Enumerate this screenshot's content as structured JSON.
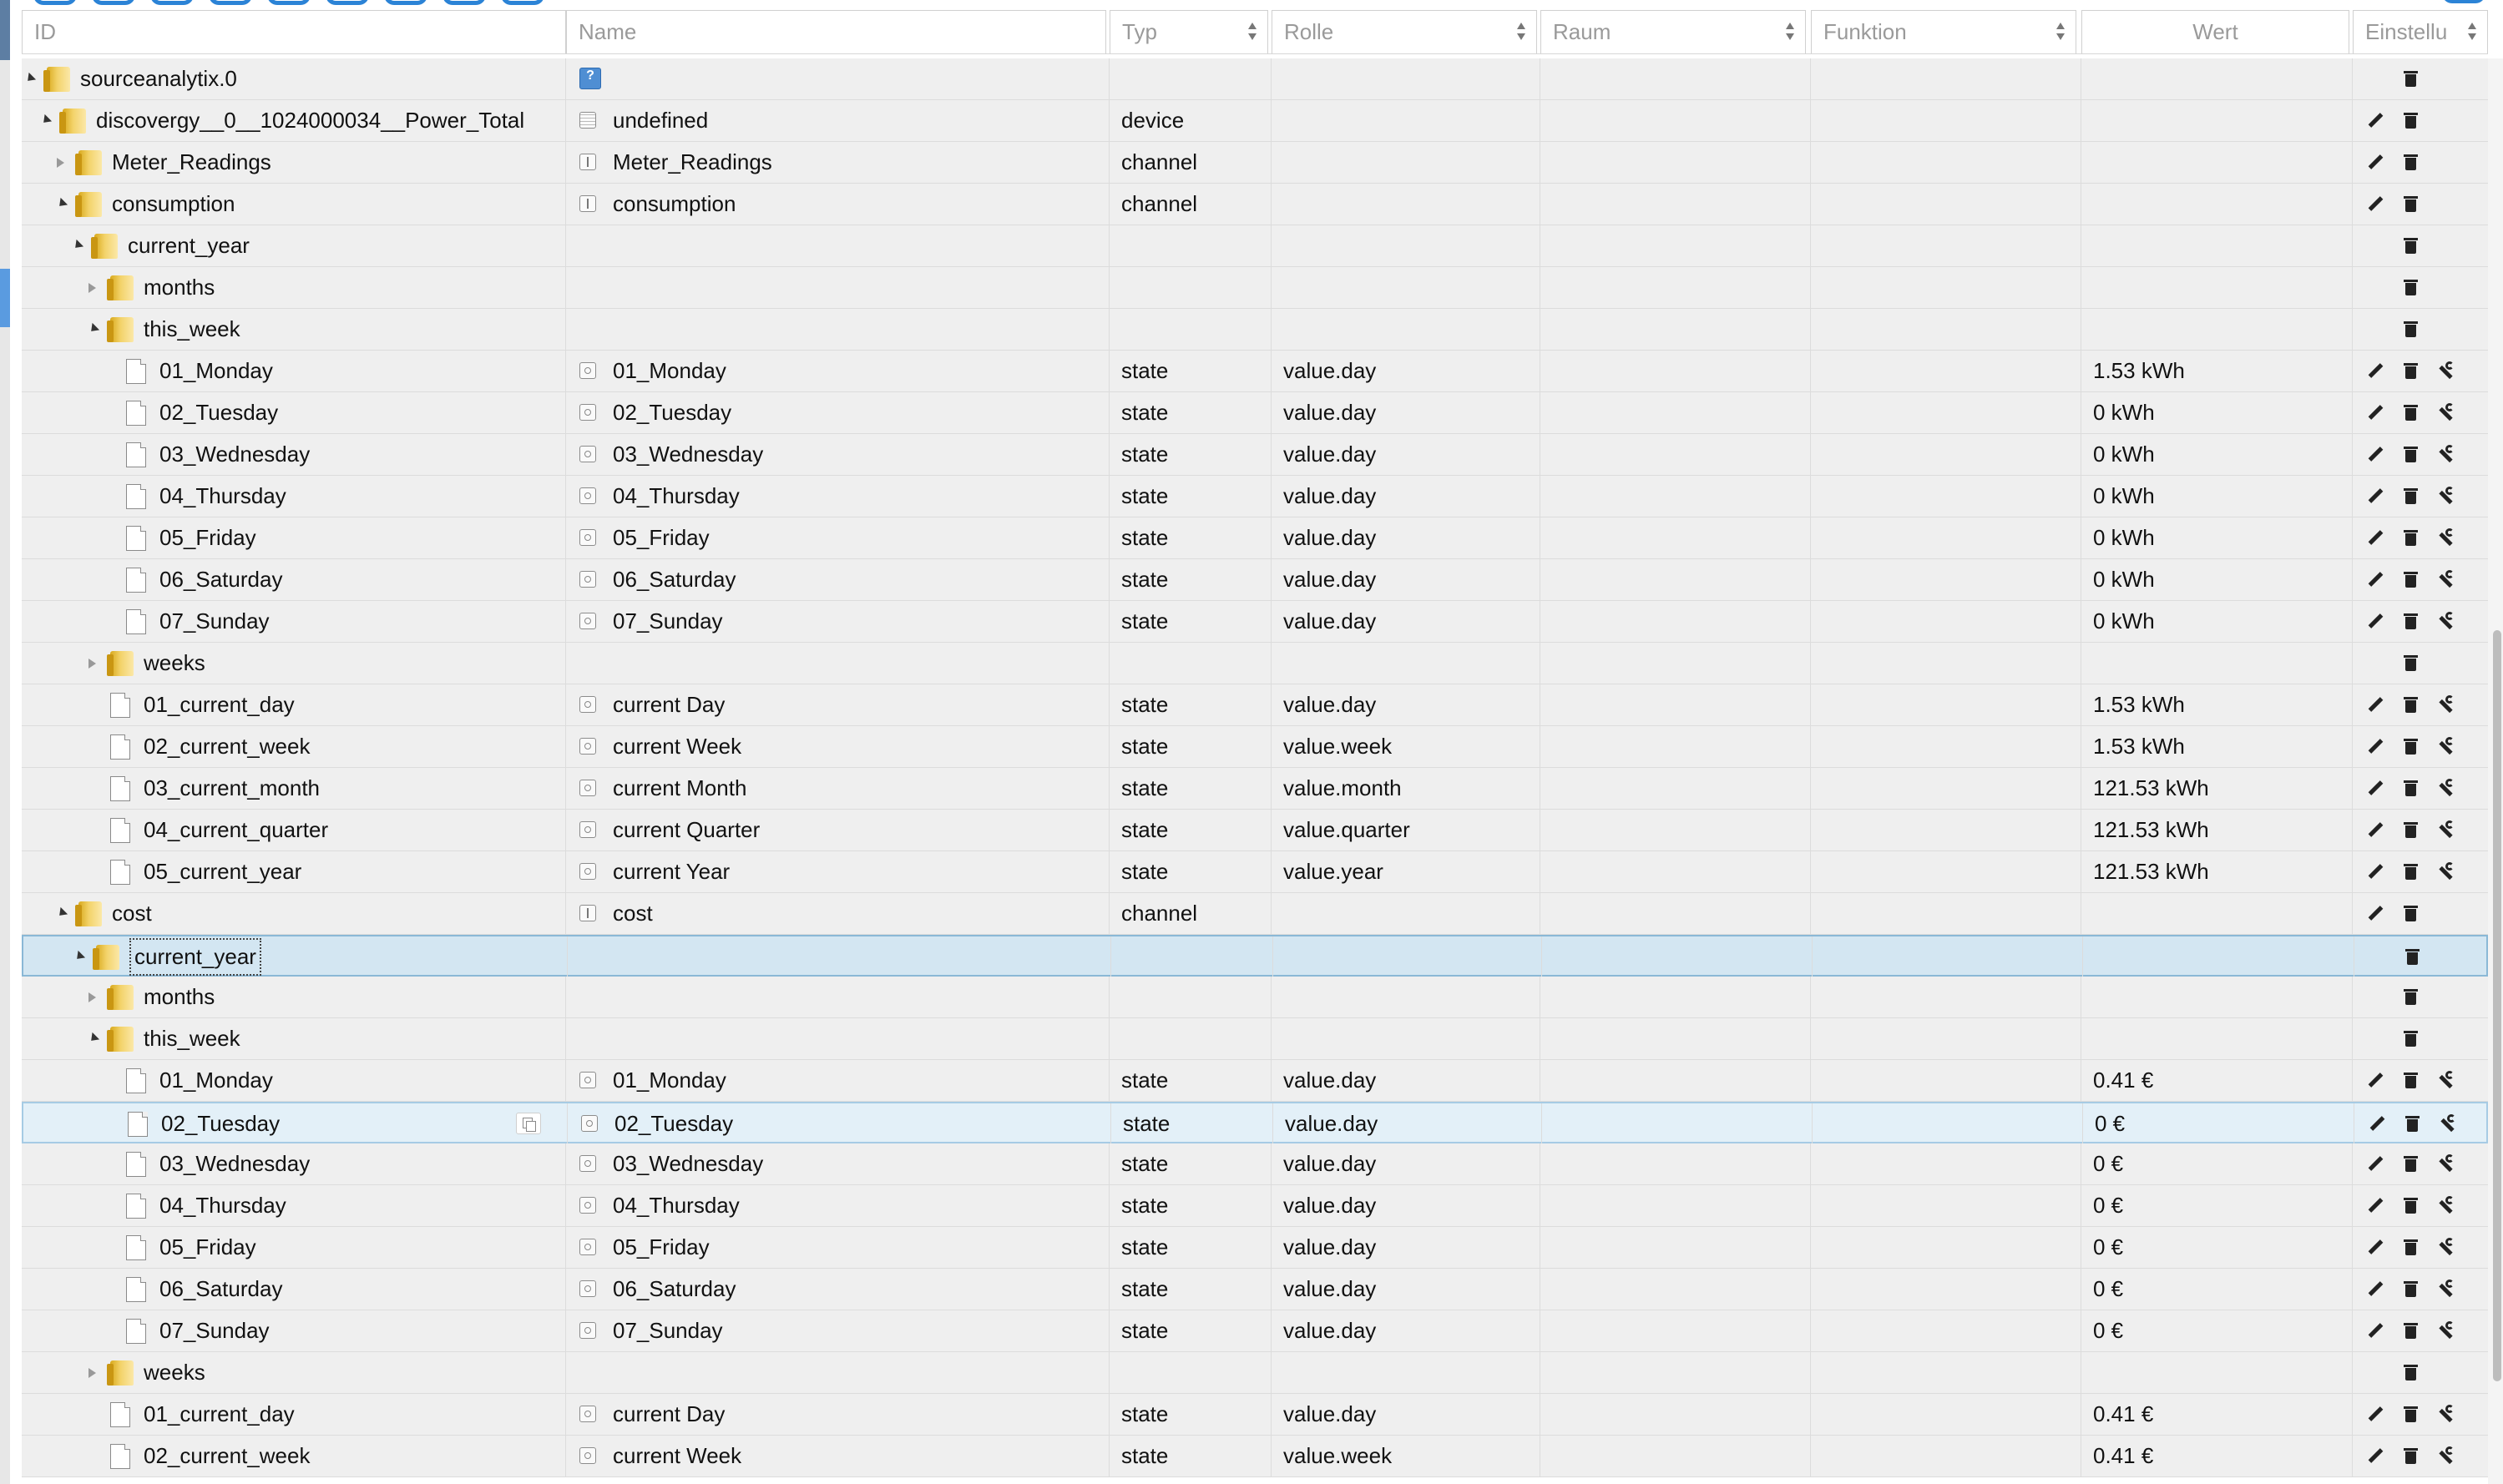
{
  "header": {
    "id": "ID",
    "name": "Name",
    "typ": "Typ",
    "rolle": "Rolle",
    "raum": "Raum",
    "funktion": "Funktion",
    "wert": "Wert",
    "einstellungen": "Einstellu"
  },
  "rows": [
    {
      "id": "sourceanalytix.0",
      "depth": 0,
      "kind": "folder",
      "twisty": "exp",
      "name_icon": "unknown-icon",
      "name": "",
      "typ": "",
      "rolle": "",
      "wert": "",
      "actions": [
        "delete"
      ]
    },
    {
      "id": "discovergy__0__1024000034__Power_Total",
      "depth": 1,
      "kind": "folder",
      "twisty": "exp",
      "name_icon": "device-icon",
      "name": "undefined",
      "typ": "device",
      "rolle": "",
      "wert": "",
      "actions": [
        "edit",
        "delete"
      ]
    },
    {
      "id": "Meter_Readings",
      "depth": 2,
      "kind": "folder",
      "twisty": "col",
      "name_icon": "channel-icon",
      "name": "Meter_Readings",
      "typ": "channel",
      "rolle": "",
      "wert": "",
      "actions": [
        "edit",
        "delete"
      ]
    },
    {
      "id": "consumption",
      "depth": 2,
      "kind": "folder",
      "twisty": "exp",
      "name_icon": "channel-icon",
      "name": "consumption",
      "typ": "channel",
      "rolle": "",
      "wert": "",
      "actions": [
        "edit",
        "delete"
      ]
    },
    {
      "id": "current_year",
      "depth": 3,
      "kind": "folder",
      "twisty": "exp",
      "name_icon": "",
      "name": "",
      "typ": "",
      "rolle": "",
      "wert": "",
      "actions": [
        "delete"
      ]
    },
    {
      "id": "months",
      "depth": 4,
      "kind": "folder",
      "twisty": "col",
      "name_icon": "",
      "name": "",
      "typ": "",
      "rolle": "",
      "wert": "",
      "actions": [
        "delete"
      ]
    },
    {
      "id": "this_week",
      "depth": 4,
      "kind": "folder",
      "twisty": "exp",
      "name_icon": "",
      "name": "",
      "typ": "",
      "rolle": "",
      "wert": "",
      "actions": [
        "delete"
      ]
    },
    {
      "id": "01_Monday",
      "depth": 5,
      "kind": "file",
      "twisty": "",
      "name_icon": "state-icon",
      "name": "01_Monday",
      "typ": "state",
      "rolle": "value.day",
      "wert": "1.53 kWh",
      "actions": [
        "edit",
        "delete",
        "wrench"
      ]
    },
    {
      "id": "02_Tuesday",
      "depth": 5,
      "kind": "file",
      "twisty": "",
      "name_icon": "state-icon",
      "name": "02_Tuesday",
      "typ": "state",
      "rolle": "value.day",
      "wert": "0 kWh",
      "actions": [
        "edit",
        "delete",
        "wrench"
      ]
    },
    {
      "id": "03_Wednesday",
      "depth": 5,
      "kind": "file",
      "twisty": "",
      "name_icon": "state-icon",
      "name": "03_Wednesday",
      "typ": "state",
      "rolle": "value.day",
      "wert": "0 kWh",
      "actions": [
        "edit",
        "delete",
        "wrench"
      ]
    },
    {
      "id": "04_Thursday",
      "depth": 5,
      "kind": "file",
      "twisty": "",
      "name_icon": "state-icon",
      "name": "04_Thursday",
      "typ": "state",
      "rolle": "value.day",
      "wert": "0 kWh",
      "actions": [
        "edit",
        "delete",
        "wrench"
      ]
    },
    {
      "id": "05_Friday",
      "depth": 5,
      "kind": "file",
      "twisty": "",
      "name_icon": "state-icon",
      "name": "05_Friday",
      "typ": "state",
      "rolle": "value.day",
      "wert": "0 kWh",
      "actions": [
        "edit",
        "delete",
        "wrench"
      ]
    },
    {
      "id": "06_Saturday",
      "depth": 5,
      "kind": "file",
      "twisty": "",
      "name_icon": "state-icon",
      "name": "06_Saturday",
      "typ": "state",
      "rolle": "value.day",
      "wert": "0 kWh",
      "actions": [
        "edit",
        "delete",
        "wrench"
      ]
    },
    {
      "id": "07_Sunday",
      "depth": 5,
      "kind": "file",
      "twisty": "",
      "name_icon": "state-icon",
      "name": "07_Sunday",
      "typ": "state",
      "rolle": "value.day",
      "wert": "0 kWh",
      "actions": [
        "edit",
        "delete",
        "wrench"
      ]
    },
    {
      "id": "weeks",
      "depth": 4,
      "kind": "folder",
      "twisty": "col",
      "name_icon": "",
      "name": "",
      "typ": "",
      "rolle": "",
      "wert": "",
      "actions": [
        "delete"
      ]
    },
    {
      "id": "01_current_day",
      "depth": 4,
      "kind": "file",
      "twisty": "",
      "name_icon": "state-icon",
      "name": "current Day",
      "typ": "state",
      "rolle": "value.day",
      "wert": "1.53 kWh",
      "actions": [
        "edit",
        "delete",
        "wrench"
      ]
    },
    {
      "id": "02_current_week",
      "depth": 4,
      "kind": "file",
      "twisty": "",
      "name_icon": "state-icon",
      "name": "current Week",
      "typ": "state",
      "rolle": "value.week",
      "wert": "1.53 kWh",
      "actions": [
        "edit",
        "delete",
        "wrench"
      ]
    },
    {
      "id": "03_current_month",
      "depth": 4,
      "kind": "file",
      "twisty": "",
      "name_icon": "state-icon",
      "name": "current Month",
      "typ": "state",
      "rolle": "value.month",
      "wert": "121.53 kWh",
      "actions": [
        "edit",
        "delete",
        "wrench"
      ]
    },
    {
      "id": "04_current_quarter",
      "depth": 4,
      "kind": "file",
      "twisty": "",
      "name_icon": "state-icon",
      "name": "current Quarter",
      "typ": "state",
      "rolle": "value.quarter",
      "wert": "121.53 kWh",
      "actions": [
        "edit",
        "delete",
        "wrench"
      ]
    },
    {
      "id": "05_current_year",
      "depth": 4,
      "kind": "file",
      "twisty": "",
      "name_icon": "state-icon",
      "name": "current Year",
      "typ": "state",
      "rolle": "value.year",
      "wert": "121.53 kWh",
      "actions": [
        "edit",
        "delete",
        "wrench"
      ]
    },
    {
      "id": "cost",
      "depth": 2,
      "kind": "folder",
      "twisty": "exp",
      "name_icon": "channel-icon",
      "name": "cost",
      "typ": "channel",
      "rolle": "",
      "wert": "",
      "actions": [
        "edit",
        "delete"
      ]
    },
    {
      "id": "current_year",
      "depth": 3,
      "kind": "folder",
      "twisty": "exp",
      "name_icon": "",
      "name": "",
      "typ": "",
      "rolle": "",
      "wert": "",
      "actions": [
        "delete"
      ],
      "state": "selected"
    },
    {
      "id": "months",
      "depth": 4,
      "kind": "folder",
      "twisty": "col",
      "name_icon": "",
      "name": "",
      "typ": "",
      "rolle": "",
      "wert": "",
      "actions": [
        "delete"
      ]
    },
    {
      "id": "this_week",
      "depth": 4,
      "kind": "folder",
      "twisty": "exp",
      "name_icon": "",
      "name": "",
      "typ": "",
      "rolle": "",
      "wert": "",
      "actions": [
        "delete"
      ]
    },
    {
      "id": "01_Monday",
      "depth": 5,
      "kind": "file",
      "twisty": "",
      "name_icon": "state-icon",
      "name": "01_Monday",
      "typ": "state",
      "rolle": "value.day",
      "wert": "0.41 €",
      "actions": [
        "edit",
        "delete",
        "wrench"
      ]
    },
    {
      "id": "02_Tuesday",
      "depth": 5,
      "kind": "file",
      "twisty": "",
      "name_icon": "state-icon",
      "name": "02_Tuesday",
      "typ": "state",
      "rolle": "value.day",
      "wert": "0 €",
      "actions": [
        "edit",
        "delete",
        "wrench"
      ],
      "state": "hover"
    },
    {
      "id": "03_Wednesday",
      "depth": 5,
      "kind": "file",
      "twisty": "",
      "name_icon": "state-icon",
      "name": "03_Wednesday",
      "typ": "state",
      "rolle": "value.day",
      "wert": "0 €",
      "actions": [
        "edit",
        "delete",
        "wrench"
      ]
    },
    {
      "id": "04_Thursday",
      "depth": 5,
      "kind": "file",
      "twisty": "",
      "name_icon": "state-icon",
      "name": "04_Thursday",
      "typ": "state",
      "rolle": "value.day",
      "wert": "0 €",
      "actions": [
        "edit",
        "delete",
        "wrench"
      ]
    },
    {
      "id": "05_Friday",
      "depth": 5,
      "kind": "file",
      "twisty": "",
      "name_icon": "state-icon",
      "name": "05_Friday",
      "typ": "state",
      "rolle": "value.day",
      "wert": "0 €",
      "actions": [
        "edit",
        "delete",
        "wrench"
      ]
    },
    {
      "id": "06_Saturday",
      "depth": 5,
      "kind": "file",
      "twisty": "",
      "name_icon": "state-icon",
      "name": "06_Saturday",
      "typ": "state",
      "rolle": "value.day",
      "wert": "0 €",
      "actions": [
        "edit",
        "delete",
        "wrench"
      ]
    },
    {
      "id": "07_Sunday",
      "depth": 5,
      "kind": "file",
      "twisty": "",
      "name_icon": "state-icon",
      "name": "07_Sunday",
      "typ": "state",
      "rolle": "value.day",
      "wert": "0 €",
      "actions": [
        "edit",
        "delete",
        "wrench"
      ]
    },
    {
      "id": "weeks",
      "depth": 4,
      "kind": "folder",
      "twisty": "col",
      "name_icon": "",
      "name": "",
      "typ": "",
      "rolle": "",
      "wert": "",
      "actions": [
        "delete"
      ]
    },
    {
      "id": "01_current_day",
      "depth": 4,
      "kind": "file",
      "twisty": "",
      "name_icon": "state-icon",
      "name": "current Day",
      "typ": "state",
      "rolle": "value.day",
      "wert": "0.41 €",
      "actions": [
        "edit",
        "delete",
        "wrench"
      ]
    },
    {
      "id": "02_current_week",
      "depth": 4,
      "kind": "file",
      "twisty": "",
      "name_icon": "state-icon",
      "name": "current Week",
      "typ": "state",
      "rolle": "value.week",
      "wert": "0.41 €",
      "actions": [
        "edit",
        "delete",
        "wrench"
      ]
    }
  ],
  "colors": {
    "accent": "#2b83d6",
    "row_bg": "#efefef",
    "selected_bg": "#d3e6f2",
    "hover_bg": "#e3f0f8"
  }
}
